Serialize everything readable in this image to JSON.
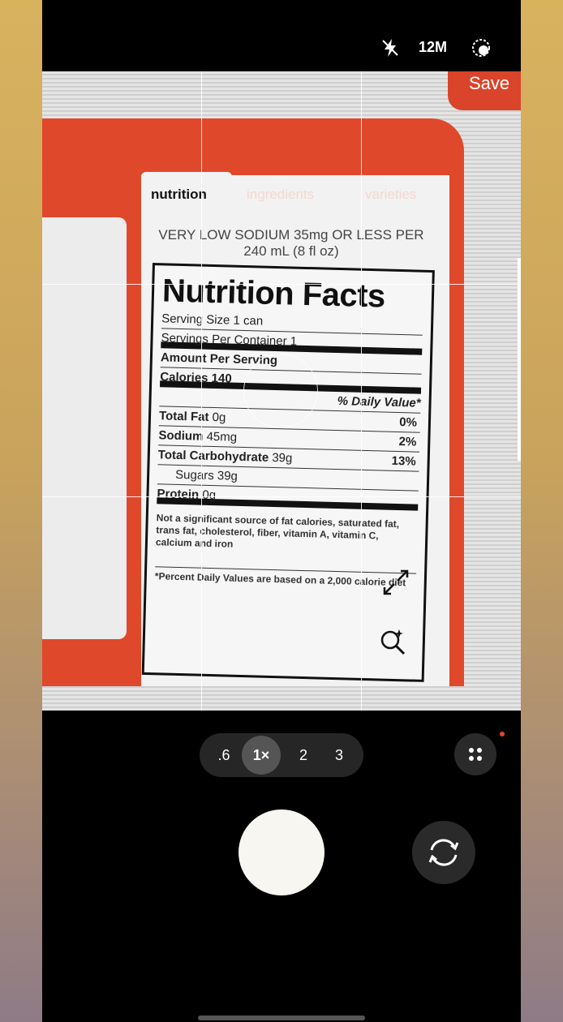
{
  "status_bar": {
    "flash_icon": "flash-off-icon",
    "resolution": "12M",
    "live_icon": "live-photo-icon"
  },
  "viewfinder": {
    "save_label": "Save",
    "tabs": [
      "nutrition",
      "ingredients",
      "varieties"
    ],
    "sodium_note": "VERY LOW SODIUM 35mg OR LESS PER 240 mL (8 fl oz)",
    "facts": {
      "title": "Nutrition Facts",
      "serving_size": "Serving Size 1 can",
      "servings_per_container": "Servings Per Container 1",
      "amount_per_serving": "Amount Per Serving",
      "calories": "Calories 140",
      "daily_value_header": "% Daily Value*",
      "rows": [
        {
          "label": "Total Fat",
          "value": "0g",
          "pct": "0%"
        },
        {
          "label": "Sodium",
          "value": "45mg",
          "pct": "2%"
        },
        {
          "label": "Total Carbohydrate",
          "value": "39g",
          "pct": "13%"
        },
        {
          "label": "Sugars",
          "value": "39g",
          "pct": ""
        },
        {
          "label": "Protein",
          "value": "0g",
          "pct": ""
        }
      ],
      "footnote": "Not a significant source of fat calories, saturated fat, trans fat, cholesterol, fiber, vitamin A, vitamin C, calcium and iron",
      "footnote2": "*Percent Daily Values are based on a 2,000 calorie diet"
    }
  },
  "controls": {
    "zoom_options": [
      ".6",
      "1×",
      "2",
      "3"
    ],
    "selected_zoom": "1×",
    "accent": "#e0482c"
  }
}
